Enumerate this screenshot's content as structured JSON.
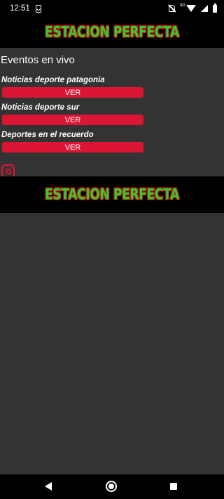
{
  "status_bar": {
    "time": "12:51",
    "network_label": "4G"
  },
  "banner": {
    "title": "ESTACION PERFECTA"
  },
  "section": {
    "heading": "Eventos en vivo"
  },
  "items": [
    {
      "title": "Noticias deporte patagonia",
      "button_label": "VER"
    },
    {
      "title": "Noticias deporte sur",
      "button_label": "VER"
    },
    {
      "title": "Deportes en el recuerdo",
      "button_label": "VER"
    }
  ],
  "colors": {
    "accent_red": "#db1634",
    "background": "#333333",
    "bars": "#000000",
    "title_green": "#33cc2b"
  },
  "icons": [
    "upload-notification-icon",
    "bell-off-icon",
    "wifi-icon",
    "signal-icon",
    "battery-icon",
    "instagram-icon",
    "back-icon",
    "home-icon",
    "recents-icon"
  ]
}
